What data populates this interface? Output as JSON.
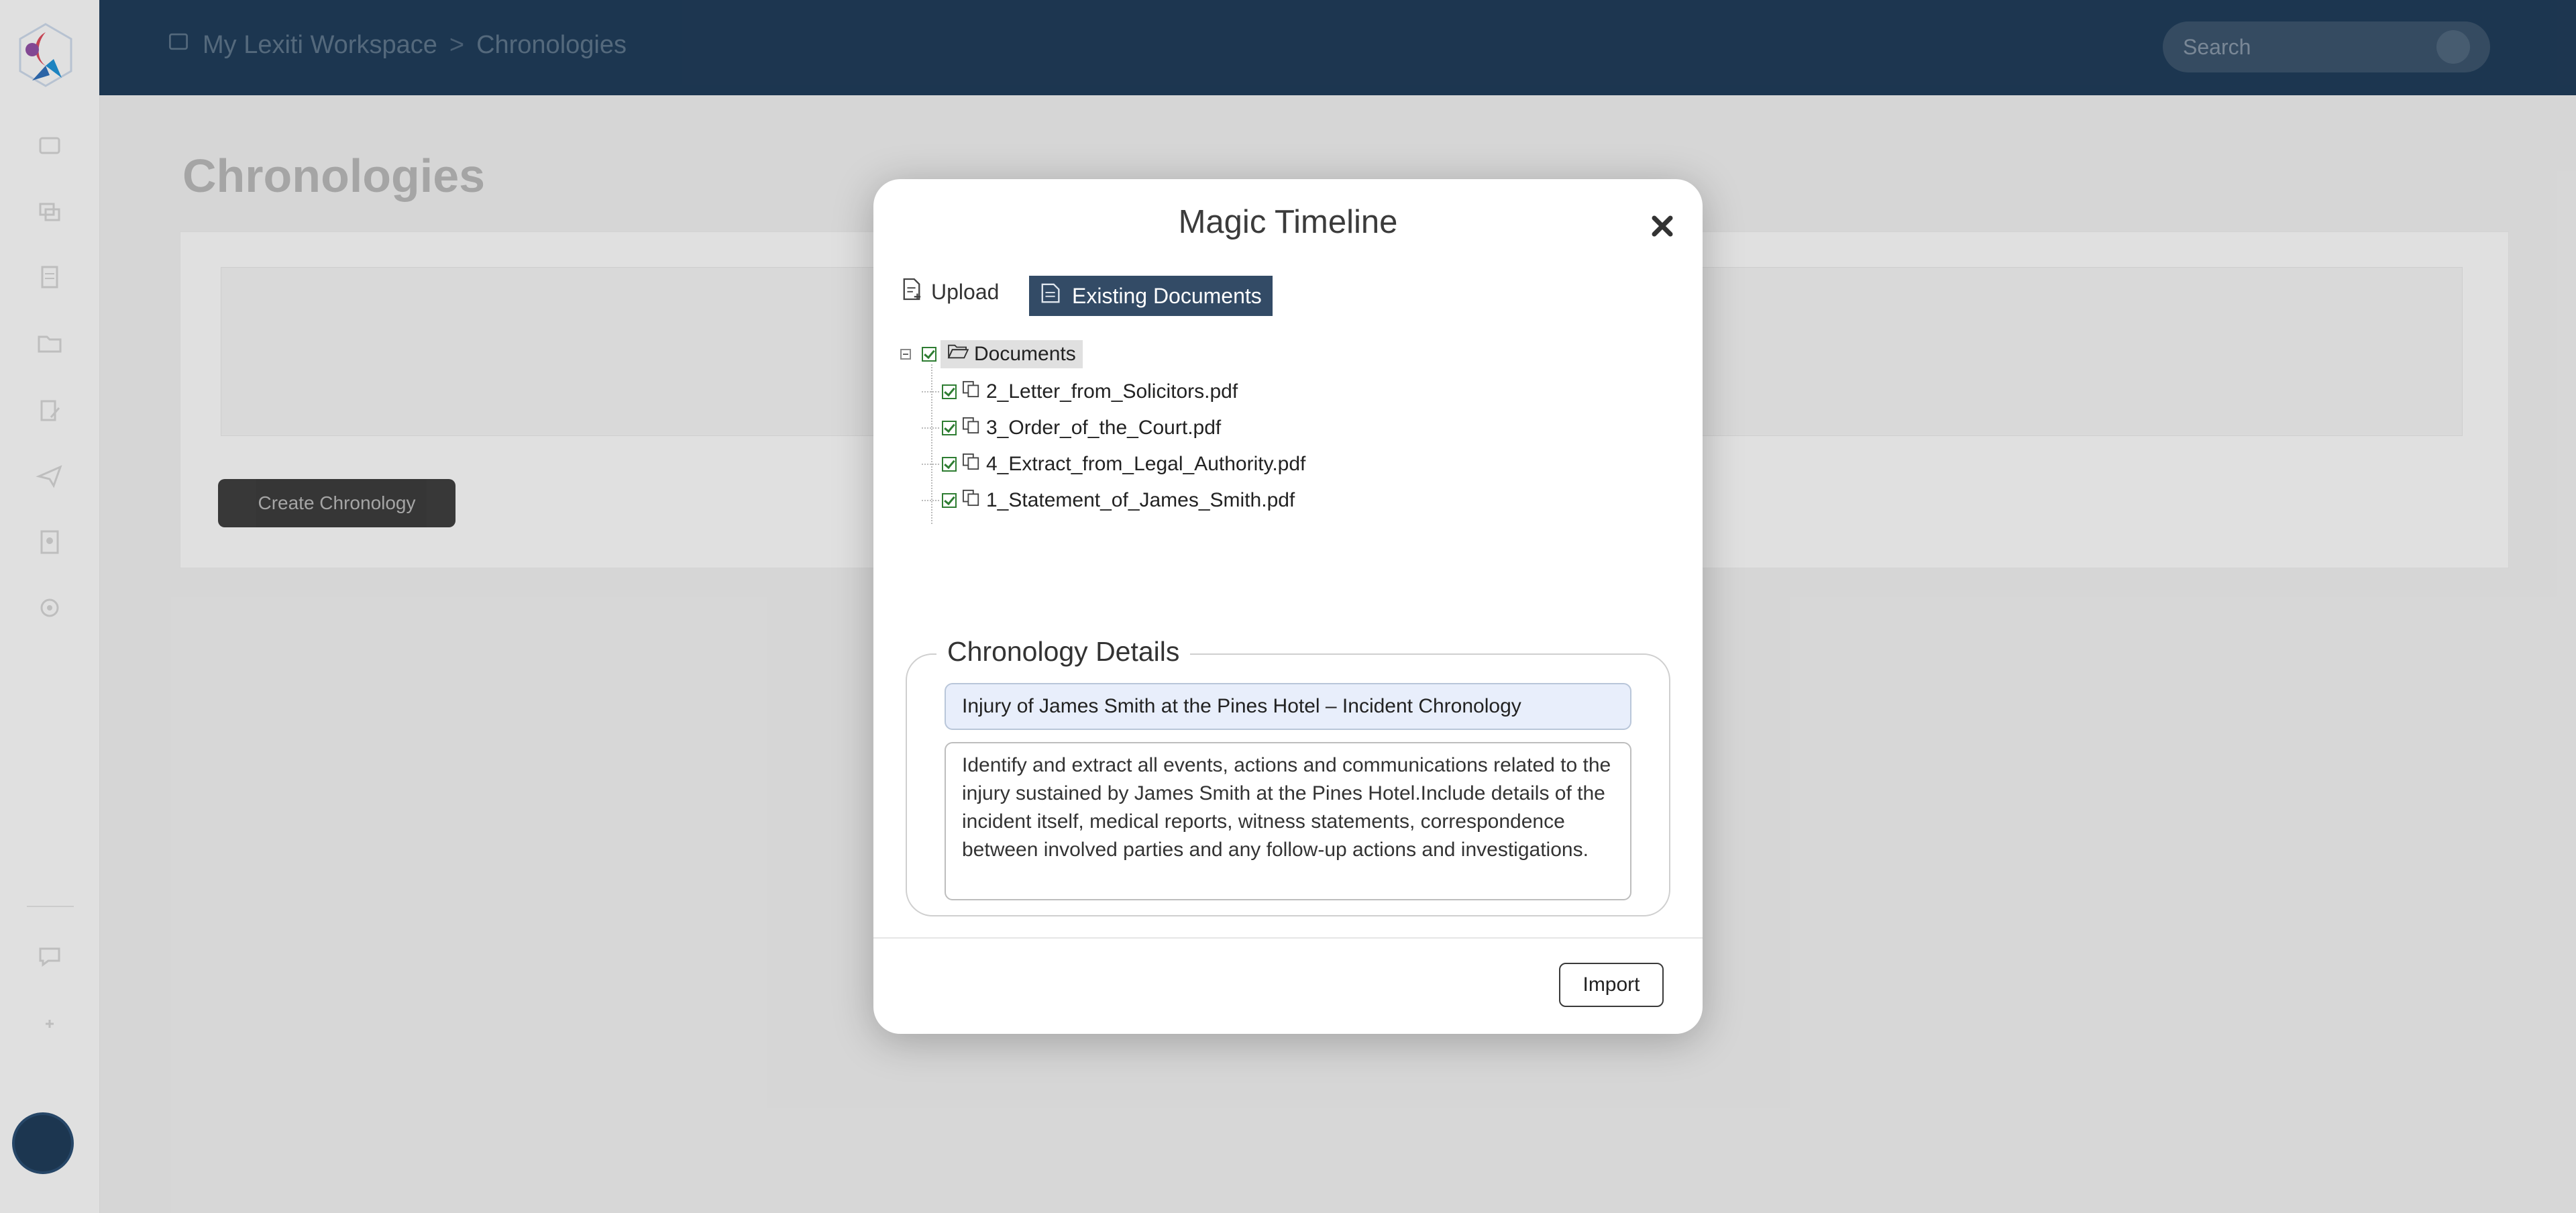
{
  "app": {
    "breadcrumb": [
      "My Lexiti Workspace",
      "Chronologies"
    ],
    "breadcrumb_separator": ">",
    "search_placeholder": "Search",
    "page_title": "Chronologies",
    "create_button_label": "Create Chronology"
  },
  "sidebar": {
    "icons": [
      "dashboard-icon",
      "matters-icon",
      "documents-icon",
      "folders-icon",
      "edit-icon",
      "send-icon",
      "reports-icon",
      "settings-icon",
      "help-icon",
      "add-icon"
    ],
    "avatar_initials": ""
  },
  "modal": {
    "title": "Magic Timeline",
    "tabs": [
      {
        "label": "Upload",
        "icon": "upload-file-icon",
        "active": false
      },
      {
        "label": "Existing Documents",
        "icon": "documents-icon",
        "active": true
      }
    ],
    "tree": {
      "root_label": "Documents",
      "root_checked": true,
      "items": [
        {
          "label": "2_Letter_from_Solicitors.pdf",
          "checked": true
        },
        {
          "label": "3_Order_of_the_Court.pdf",
          "checked": true
        },
        {
          "label": "4_Extract_from_Legal_Authority.pdf",
          "checked": true
        },
        {
          "label": "1_Statement_of_James_Smith.pdf",
          "checked": true
        }
      ]
    },
    "details": {
      "legend": "Chronology Details",
      "title_value": "Injury of James Smith at the Pines Hotel – Incident Chronology",
      "prompt_value": "Identify and extract all events, actions and communications related to the injury sustained by James Smith at the Pines Hotel.Include details of the incident itself, medical reports, witness statements, correspondence between involved parties and any follow-up actions and investigations."
    },
    "import_label": "Import"
  },
  "colors": {
    "topbar": "#1f3b57",
    "active_tab": "#334b66",
    "checkbox": "#2e7d32"
  }
}
